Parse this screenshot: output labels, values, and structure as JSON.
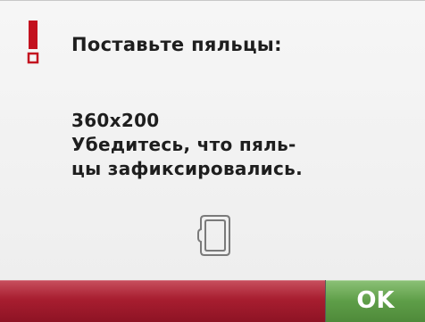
{
  "dialog": {
    "title": "Поставьте пяльцы:",
    "hoop_size": "360x200",
    "message_line1": "Убедитесь, что пяль-",
    "message_line2": "цы зафиксировались.",
    "warning_icon": "exclamation-icon",
    "hoop_icon": "hoop-icon"
  },
  "footer": {
    "ok_label": "OK"
  },
  "colors": {
    "warning": "#c3121f",
    "progress_bar": "#a81e30",
    "ok_button": "#5e9e48",
    "text": "#1e1e1e"
  }
}
